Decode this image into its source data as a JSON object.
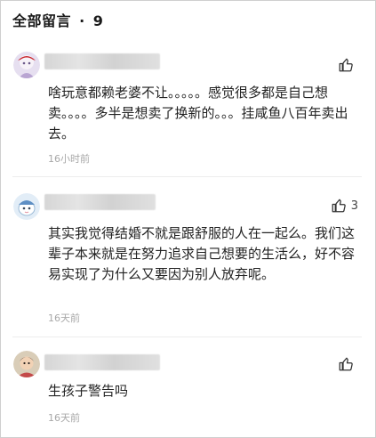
{
  "header": {
    "title": "全部留言",
    "dot": "·",
    "count": "9"
  },
  "comments": [
    {
      "text": "啥玩意都赖老婆不让。。。。。感觉很多都是自己想卖。。。。多半是想卖了换新的。。。挂咸鱼八百年卖出去。",
      "time": "16小时前",
      "likes": ""
    },
    {
      "text": "其实我觉得结婚不就是跟舒服的人在一起么。我们这辈子本来就是在努力追求自己想要的生活么，好不容易实现了为什么又要因为别人放弃呢。",
      "time": "16天前",
      "likes": "3"
    },
    {
      "text": "生孩子警告吗",
      "time": "16天前",
      "likes": ""
    }
  ]
}
